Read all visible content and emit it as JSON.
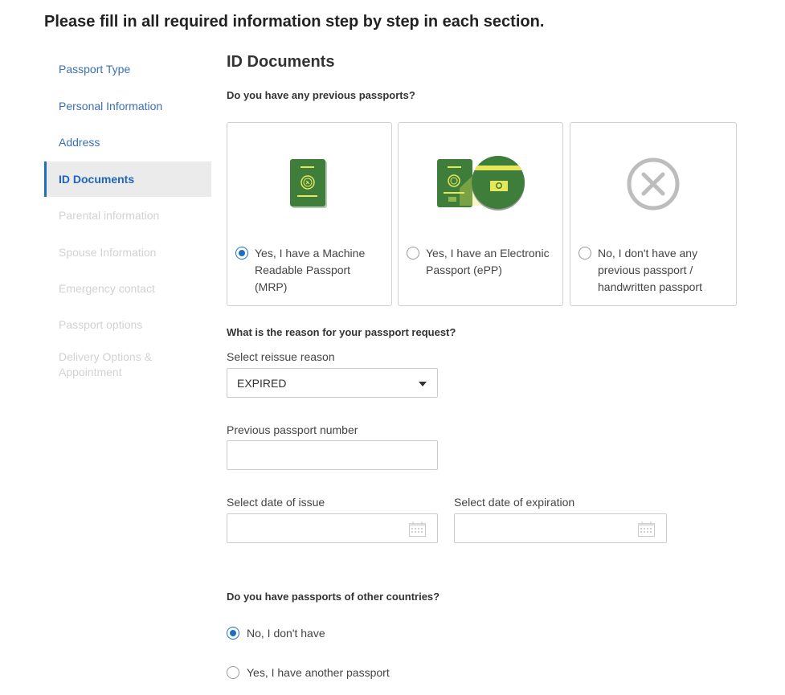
{
  "page": {
    "heading": "Please fill in all required information step by step in each section."
  },
  "sidebar": {
    "items": [
      {
        "label": "Passport Type",
        "state": "done"
      },
      {
        "label": "Personal Information",
        "state": "done"
      },
      {
        "label": "Address",
        "state": "done"
      },
      {
        "label": "ID Documents",
        "state": "active"
      },
      {
        "label": "Parental information",
        "state": "disabled"
      },
      {
        "label": "Spouse Information",
        "state": "disabled"
      },
      {
        "label": "Emergency contact",
        "state": "disabled"
      },
      {
        "label": "Passport options",
        "state": "disabled"
      },
      {
        "label": "Delivery Options & Appointment",
        "state": "disabled"
      }
    ]
  },
  "main": {
    "title": "ID Documents",
    "previous_passports": {
      "question": "Do you have any previous passports?",
      "options": [
        {
          "label": "Yes, I have a Machine Readable Passport (MRP)",
          "icon": "mrp-passport-icon",
          "selected": true
        },
        {
          "label": "Yes, I have an Electronic Passport (ePP)",
          "icon": "electronic-passport-icon",
          "selected": false
        },
        {
          "label": "No, I don't have any previous passport / handwritten passport",
          "icon": "no-passport-icon",
          "selected": false
        }
      ]
    },
    "reason": {
      "question": "What is the reason for your passport request?",
      "select_label": "Select reissue reason",
      "select_value": "EXPIRED"
    },
    "previous_number": {
      "label": "Previous passport number",
      "value": ""
    },
    "date_issue": {
      "label": "Select date of issue",
      "value": "",
      "icon": "calendar-icon"
    },
    "date_expiration": {
      "label": "Select date of expiration",
      "value": "",
      "icon": "calendar-icon"
    },
    "other_countries": {
      "question": "Do you have passports of other countries?",
      "options": [
        {
          "label": "No, I don't have",
          "selected": true
        },
        {
          "label": "Yes, I have another passport",
          "selected": false
        }
      ]
    }
  },
  "colors": {
    "accent": "#1f6fc0",
    "link": "#3a6fb5",
    "disabled": "#d2d2d2",
    "passport_green": "#3f7d3a",
    "passport_yellow": "#e6e85a"
  }
}
